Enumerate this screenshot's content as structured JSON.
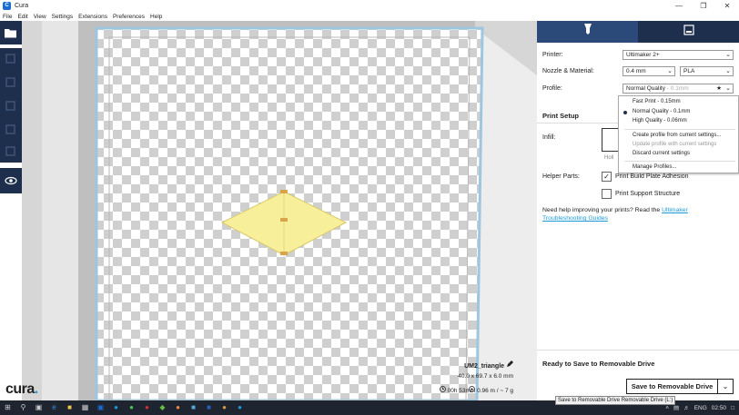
{
  "window": {
    "title": "Cura",
    "minimize": "—",
    "maximize": "❐",
    "close": "✕"
  },
  "menu": [
    "File",
    "Edit",
    "View",
    "Settings",
    "Extensions",
    "Preferences",
    "Help"
  ],
  "brand": {
    "name": "cura",
    "dot": "."
  },
  "object": {
    "name": "UM2_triangle",
    "dimensions": "40.0 x 69.7 x 6.0 mm",
    "time": "00h 53min",
    "material": "0.96 m / ~ 7 g"
  },
  "panel": {
    "printer_label": "Printer:",
    "printer_value": "Ultimaker 2+",
    "nozzle_label": "Nozzle & Material:",
    "nozzle_value": "0.4 mm",
    "material_value": "PLA",
    "profile_label": "Profile:",
    "profile_value": "Normal Quality",
    "profile_sub": "- 0.1mm",
    "print_setup": "Print Setup",
    "infill_label": "Infill:",
    "infill_caption": "Holl",
    "helper_label": "Helper Parts:",
    "adhesion_label": "Print Build Plate Adhesion",
    "support_label": "Print Support Structure",
    "help_text": "Need help improving your prints? Read the ",
    "help_link1": "Ultimaker",
    "help_link2": "Troubleshooting Guides",
    "ready_text": "Ready to Save to Removable Drive",
    "save_button": "Save to Removable Drive"
  },
  "dropdown": {
    "items": [
      "Fast Print - 0.15mm",
      "Normal Quality - 0.1mm",
      "High Quality - 0.06mm"
    ],
    "create": "Create profile from current settings...",
    "update": "Update profile with current settings",
    "discard": "Discard current settings",
    "manage": "Manage Profiles..."
  },
  "tooltip": "Save to Removable Drive Removable Drive (L:)",
  "tray": {
    "lang": "ENG",
    "time": "02:50"
  },
  "colors": {
    "navy": "#1e2f4d",
    "accent": "#1b9ad6",
    "model": "#f7ef9a"
  }
}
